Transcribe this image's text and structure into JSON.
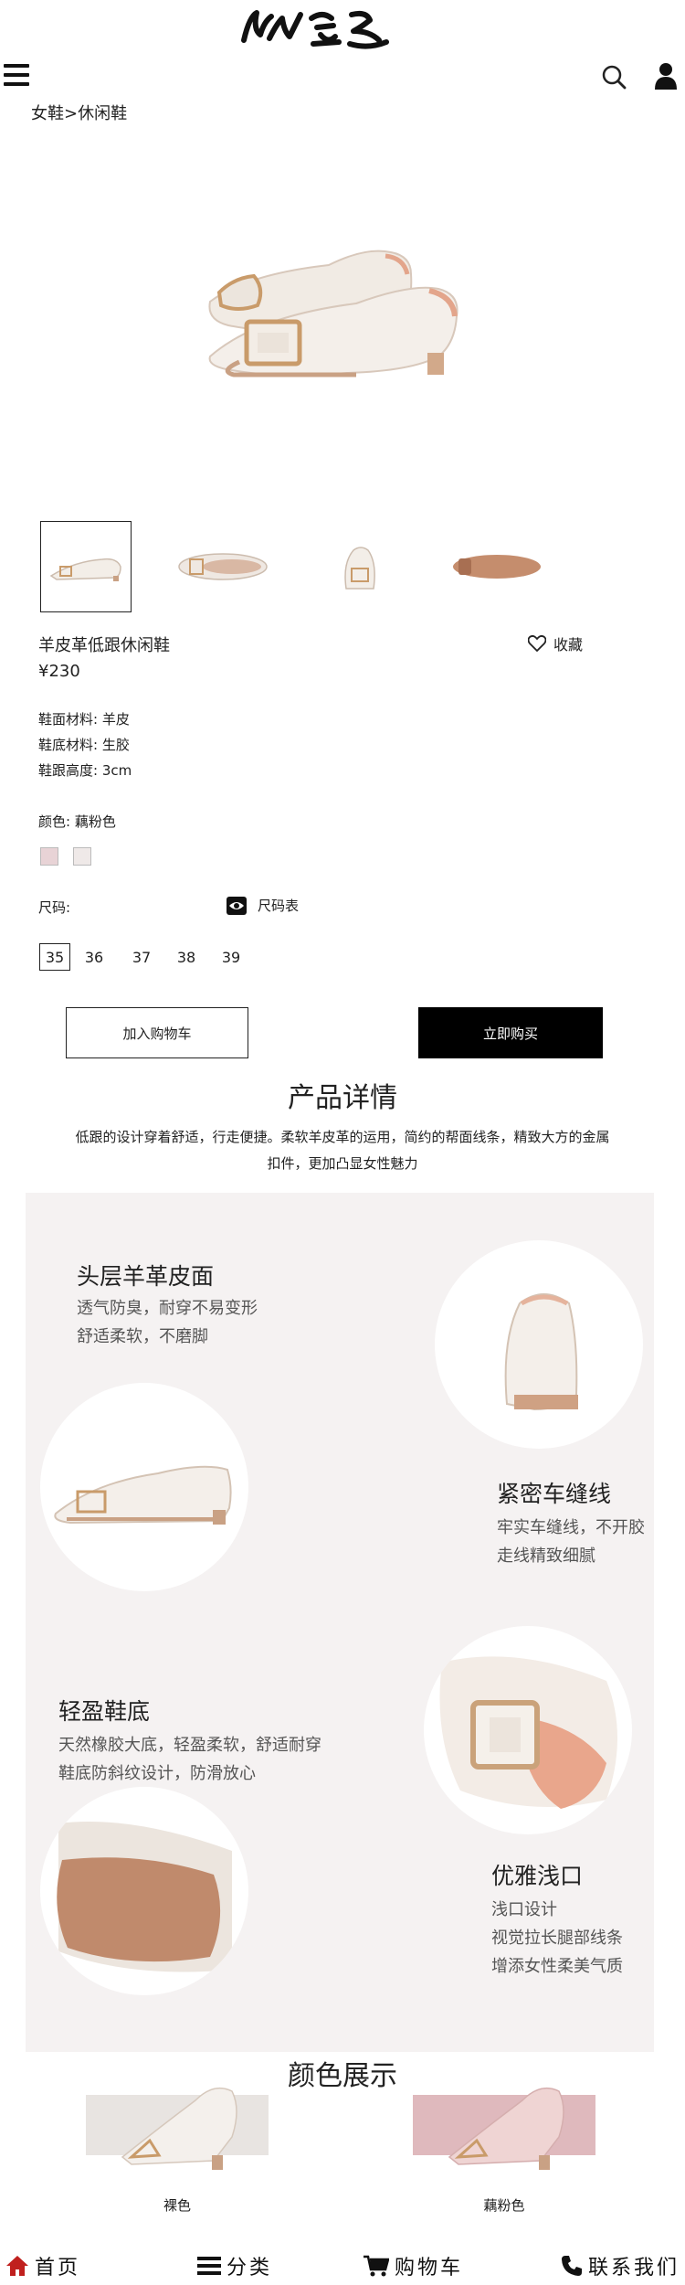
{
  "header": {
    "logo_text": "",
    "breadcrumb": [
      "女鞋",
      "休闲鞋"
    ],
    "breadcrumb_sep": ">"
  },
  "product": {
    "name": "羊皮革低跟休闲鞋",
    "favorite_label": "收藏",
    "price": "¥230",
    "specs": [
      "鞋面材料: 羊皮",
      "鞋底材料: 生胶",
      "鞋跟高度: 3cm"
    ],
    "color_label": "颜色: 藕粉色",
    "swatch_colors": [
      "#e8d3d6",
      "#efe9e8"
    ],
    "size_label": "尺码:",
    "size_chart_label": "尺码表",
    "sizes": [
      "35",
      "36",
      "37",
      "38",
      "39"
    ],
    "selected_size": "35",
    "add_to_cart": "加入购物车",
    "buy_now": "立即购买"
  },
  "details": {
    "title": "产品详情",
    "description": "低跟的设计穿着舒适，行走便捷。柔软羊皮革的运用，简约的帮面线条，精致大方的金属扣件，更加凸显女性魅力",
    "features": [
      {
        "title": "头层羊革皮面",
        "lines": [
          "透气防臭，耐穿不易变形",
          "舒适柔软，不磨脚"
        ]
      },
      {
        "title": "紧密车缝线",
        "lines": [
          "牢实车缝线，不开胶",
          "走线精致细腻"
        ]
      },
      {
        "title": "轻盈鞋底",
        "lines": [
          "天然橡胶大底，轻盈柔软，舒适耐穿",
          "鞋底防斜纹设计，防滑放心"
        ]
      },
      {
        "title": "优雅浅口",
        "lines": [
          "浅口设计",
          "视觉拉长腿部线条",
          "增添女性柔美气质"
        ]
      }
    ]
  },
  "colors": {
    "title": "颜色展示",
    "items": [
      {
        "name": "裸色",
        "bg": "#e8e4e1"
      },
      {
        "name": "藕粉色",
        "bg": "#dfb9bd"
      }
    ]
  },
  "nav": {
    "home": "首页",
    "category": "分类",
    "cart": "购物车",
    "contact": "联系我们"
  },
  "accent": "#c0201e"
}
